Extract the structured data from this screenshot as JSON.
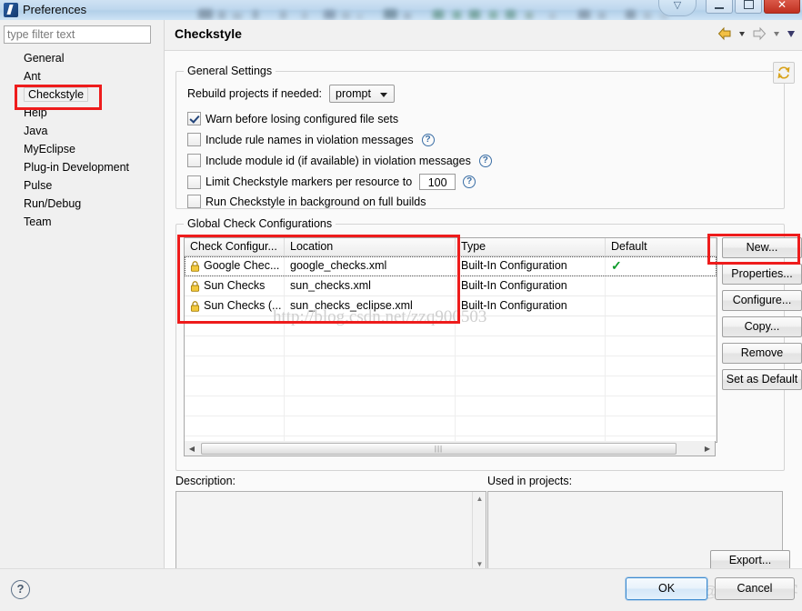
{
  "window": {
    "title": "Preferences",
    "icon": "eclipse-icon",
    "controls": {
      "restore_up": "restore-up-icon",
      "minimize": "minimize-icon",
      "maximize": "maximize-icon",
      "close": "close-icon"
    }
  },
  "sidebar": {
    "filter_placeholder": "type filter text",
    "filter_value": "",
    "items": [
      {
        "label": "General",
        "selected": false
      },
      {
        "label": "Ant",
        "selected": false
      },
      {
        "label": "Checkstyle",
        "selected": true
      },
      {
        "label": "Help",
        "selected": false
      },
      {
        "label": "Java",
        "selected": false
      },
      {
        "label": "MyEclipse",
        "selected": false
      },
      {
        "label": "Plug-in Development",
        "selected": false
      },
      {
        "label": "Pulse",
        "selected": false
      },
      {
        "label": "Run/Debug",
        "selected": false
      },
      {
        "label": "Team",
        "selected": false
      }
    ]
  },
  "header": {
    "title": "Checkstyle",
    "back_icon": "back-arrow-icon",
    "back_menu_icon": "chevron-down-icon",
    "forward_icon": "forward-arrow-icon",
    "forward_menu_icon": "chevron-down-icon",
    "view_menu_icon": "chevron-down-icon"
  },
  "general_settings": {
    "group_title": "General Settings",
    "rebuild_label": "Rebuild projects if needed:",
    "rebuild_value": "prompt",
    "sync_icon": "refresh-icon",
    "checkboxes": [
      {
        "label": "Warn before losing configured file sets",
        "checked": true,
        "help": false
      },
      {
        "label": "Include rule names in violation messages",
        "checked": false,
        "help": true
      },
      {
        "label": "Include module id (if available) in violation messages",
        "checked": false,
        "help": true
      },
      {
        "label": "Limit Checkstyle markers per resource to",
        "checked": false,
        "help": true,
        "field_value": "100"
      },
      {
        "label": "Run Checkstyle in background on full builds",
        "checked": false,
        "help": false
      }
    ]
  },
  "global_check_configurations": {
    "group_title": "Global Check Configurations",
    "columns": [
      "Check Configur...",
      "Location",
      "Type",
      "Default"
    ],
    "rows": [
      {
        "icon": "lock-icon",
        "name": "Google Chec...",
        "location": "google_checks.xml",
        "type": "Built-In Configuration",
        "default": "✓",
        "focused": true
      },
      {
        "icon": "lock-icon",
        "name": "Sun Checks",
        "location": "sun_checks.xml",
        "type": "Built-In Configuration",
        "default": "",
        "focused": false
      },
      {
        "icon": "lock-icon",
        "name": "Sun Checks (...",
        "location": "sun_checks_eclipse.xml",
        "type": "Built-In Configuration",
        "default": "",
        "focused": false
      }
    ],
    "scrollbar": {
      "left_arrow": "scroll-left-icon",
      "right_arrow": "scroll-right-icon",
      "grip": "|||"
    },
    "buttons": [
      "New...",
      "Properties...",
      "Configure...",
      "Copy...",
      "Remove",
      "Set as Default"
    ]
  },
  "description_panel": {
    "label": "Description:",
    "value": ""
  },
  "used_in_projects_panel": {
    "label": "Used in projects:",
    "value": ""
  },
  "export_button": "Export...",
  "footer": {
    "help_icon": "help-icon",
    "ok": "OK",
    "cancel": "Cancel"
  },
  "watermarks": {
    "url": "http://blog.csdn.net/zzq900503",
    "brand": "@51CTO博客"
  },
  "colors": {
    "annotation": "#ee1c1c",
    "default_tick": "#0a9b28",
    "titlebar": "#bfd8ee",
    "ok_border": "#3c8ad0"
  }
}
